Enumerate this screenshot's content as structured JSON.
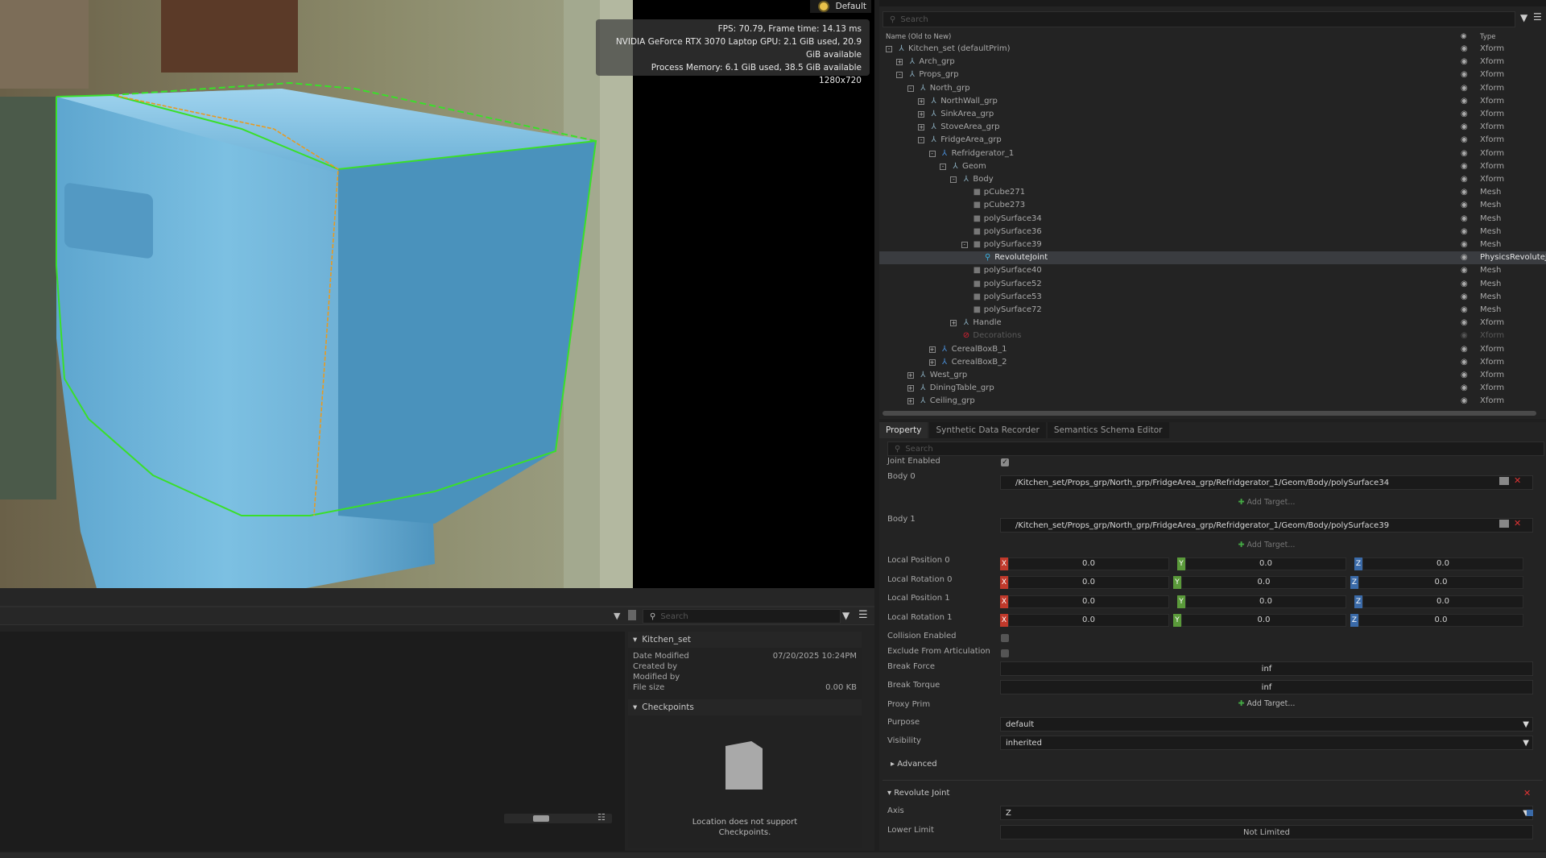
{
  "viewport": {
    "stats": [
      "FPS: 70.79, Frame time: 14.13 ms",
      "NVIDIA GeForce RTX 3070 Laptop GPU: 2.1 GiB used, 20.9 GiB available",
      "Process Memory: 6.1 GiB used, 38.5 GiB available",
      "1280x720"
    ],
    "lighting_label": "Default"
  },
  "content": {
    "search_placeholder": "Search",
    "detail_title": "Kitchen_set",
    "date_modified_label": "Date Modified",
    "date_modified": "07/20/2025 10:24PM",
    "created_by_label": "Created by",
    "modified_by_label": "Modified by",
    "file_size_label": "File size",
    "file_size": "0.00 KB",
    "checkpoints_label": "Checkpoints",
    "checkpoints_msg": "Location does not support Checkpoints."
  },
  "stage": {
    "search_placeholder": "Search",
    "col_name": "Name (Old to New)",
    "col_type": "Type",
    "rows": [
      {
        "label": "Kitchen_set (defaultPrim)",
        "type": "Xform",
        "depth": 0,
        "exp": "-",
        "icon": "xform"
      },
      {
        "label": "Arch_grp",
        "type": "Xform",
        "depth": 1,
        "exp": "+",
        "icon": "xform"
      },
      {
        "label": "Props_grp",
        "type": "Xform",
        "depth": 1,
        "exp": "-",
        "icon": "xform"
      },
      {
        "label": "North_grp",
        "type": "Xform",
        "depth": 2,
        "exp": "-",
        "icon": "xform"
      },
      {
        "label": "NorthWall_grp",
        "type": "Xform",
        "depth": 3,
        "exp": "+",
        "icon": "xform"
      },
      {
        "label": "SinkArea_grp",
        "type": "Xform",
        "depth": 3,
        "exp": "+",
        "icon": "xform"
      },
      {
        "label": "StoveArea_grp",
        "type": "Xform",
        "depth": 3,
        "exp": "+",
        "icon": "xform"
      },
      {
        "label": "FridgeArea_grp",
        "type": "Xform",
        "depth": 3,
        "exp": "-",
        "icon": "xform"
      },
      {
        "label": "Refridgerator_1",
        "type": "Xform",
        "depth": 4,
        "exp": "-",
        "icon": "ref"
      },
      {
        "label": "Geom",
        "type": "Xform",
        "depth": 5,
        "exp": "-",
        "icon": "xform"
      },
      {
        "label": "Body",
        "type": "Xform",
        "depth": 6,
        "exp": "-",
        "icon": "xform"
      },
      {
        "label": "pCube271",
        "type": "Mesh",
        "depth": 7,
        "exp": "",
        "icon": "mesh"
      },
      {
        "label": "pCube273",
        "type": "Mesh",
        "depth": 7,
        "exp": "",
        "icon": "mesh"
      },
      {
        "label": "polySurface34",
        "type": "Mesh",
        "depth": 7,
        "exp": "",
        "icon": "mesh"
      },
      {
        "label": "polySurface36",
        "type": "Mesh",
        "depth": 7,
        "exp": "",
        "icon": "mesh"
      },
      {
        "label": "polySurface39",
        "type": "Mesh",
        "depth": 7,
        "exp": "-",
        "icon": "mesh"
      },
      {
        "label": "RevoluteJoint",
        "type": "PhysicsRevoluteJoint",
        "depth": 8,
        "exp": "",
        "icon": "joint",
        "selected": true
      },
      {
        "label": "polySurface40",
        "type": "Mesh",
        "depth": 7,
        "exp": "",
        "icon": "mesh"
      },
      {
        "label": "polySurface52",
        "type": "Mesh",
        "depth": 7,
        "exp": "",
        "icon": "mesh"
      },
      {
        "label": "polySurface53",
        "type": "Mesh",
        "depth": 7,
        "exp": "",
        "icon": "mesh"
      },
      {
        "label": "polySurface72",
        "type": "Mesh",
        "depth": 7,
        "exp": "",
        "icon": "mesh"
      },
      {
        "label": "Handle",
        "type": "Xform",
        "depth": 6,
        "exp": "+",
        "icon": "xform"
      },
      {
        "label": "Decorations",
        "type": "Xform",
        "depth": 6,
        "exp": "",
        "icon": "blocked",
        "dim": true
      },
      {
        "label": "CerealBoxB_1",
        "type": "Xform",
        "depth": 4,
        "exp": "+",
        "icon": "ref"
      },
      {
        "label": "CerealBoxB_2",
        "type": "Xform",
        "depth": 4,
        "exp": "+",
        "icon": "ref"
      },
      {
        "label": "West_grp",
        "type": "Xform",
        "depth": 2,
        "exp": "+",
        "icon": "xform"
      },
      {
        "label": "DiningTable_grp",
        "type": "Xform",
        "depth": 2,
        "exp": "+",
        "icon": "xform"
      },
      {
        "label": "Ceiling_grp",
        "type": "Xform",
        "depth": 2,
        "exp": "+",
        "icon": "xform"
      }
    ]
  },
  "property": {
    "tabs": [
      "Property",
      "Synthetic Data Recorder",
      "Semantics Schema Editor"
    ],
    "search_placeholder": "Search",
    "joint_enabled": "Joint Enabled",
    "body0": "Body 0",
    "body0_path": "/Kitchen_set/Props_grp/North_grp/FridgeArea_grp/Refridgerator_1/Geom/Body/polySurface34",
    "body1": "Body 1",
    "body1_path": "/Kitchen_set/Props_grp/North_grp/FridgeArea_grp/Refridgerator_1/Geom/Body/polySurface39",
    "add_target": "Add Target...",
    "local_position_0": "Local Position 0",
    "local_rotation_0": "Local Rotation 0",
    "local_position_1": "Local Position 1",
    "local_rotation_1": "Local Rotation 1",
    "zero": "0.0",
    "collision_enabled": "Collision Enabled",
    "exclude_articulation": "Exclude From Articulation",
    "break_force": "Break Force",
    "break_torque": "Break Torque",
    "inf": "inf",
    "proxy_prim": "Proxy Prim",
    "purpose": "Purpose",
    "purpose_value": "default",
    "visibility": "Visibility",
    "visibility_value": "inherited",
    "advanced": "Advanced",
    "revolute_joint": "Revolute Joint",
    "axis": "Axis",
    "axis_value": "Z",
    "lower_limit": "Lower Limit",
    "not_limited": "Not Limited"
  },
  "colors": {
    "x_axis": "#c0392b",
    "y_axis": "#5a9a3a",
    "z_axis": "#3a6aa8",
    "selection_green": "#3adf2a",
    "selection_orange": "#e89a20"
  }
}
